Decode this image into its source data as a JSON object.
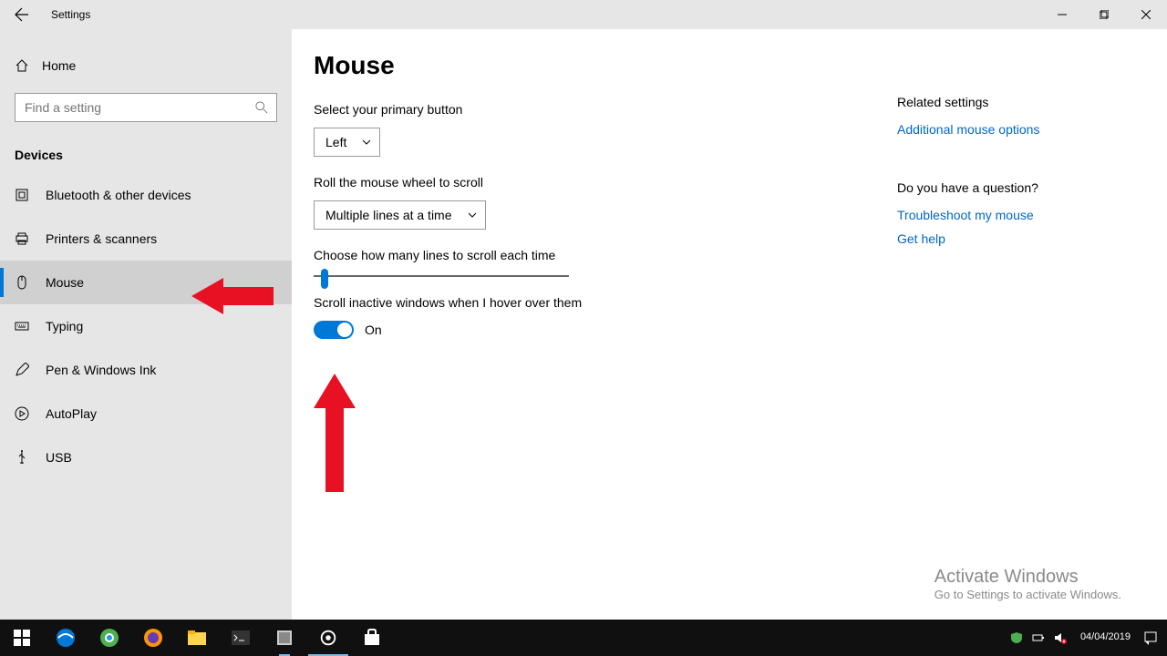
{
  "titlebar": {
    "title": "Settings"
  },
  "sidebar": {
    "home": "Home",
    "search_placeholder": "Find a setting",
    "section": "Devices",
    "items": [
      {
        "label": "Bluetooth & other devices"
      },
      {
        "label": "Printers & scanners"
      },
      {
        "label": "Mouse"
      },
      {
        "label": "Typing"
      },
      {
        "label": "Pen & Windows Ink"
      },
      {
        "label": "AutoPlay"
      },
      {
        "label": "USB"
      }
    ]
  },
  "page": {
    "title": "Mouse",
    "primary_button_label": "Select your primary button",
    "primary_button_value": "Left",
    "roll_label": "Roll the mouse wheel to scroll",
    "roll_value": "Multiple lines at a time",
    "lines_label": "Choose how many lines to scroll each time",
    "inactive_label": "Scroll inactive windows when I hover over them",
    "inactive_value": "On"
  },
  "related": {
    "header": "Related settings",
    "link1": "Additional mouse options",
    "question_header": "Do you have a question?",
    "link2": "Troubleshoot my mouse",
    "link3": "Get help"
  },
  "watermark": {
    "title": "Activate Windows",
    "sub": "Go to Settings to activate Windows."
  },
  "taskbar": {
    "time": "04/04/2019"
  }
}
